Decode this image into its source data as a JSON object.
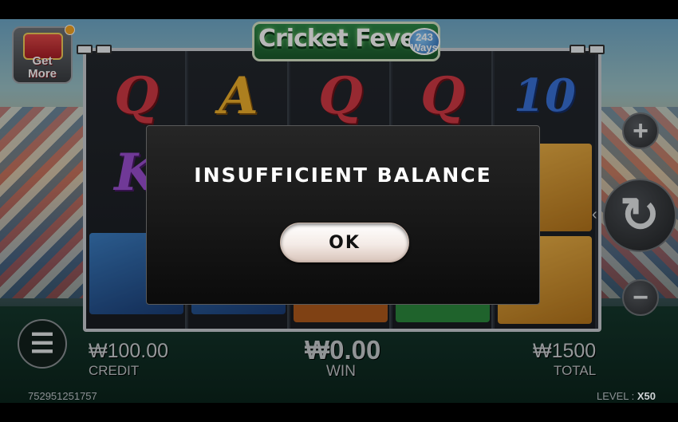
{
  "game": {
    "title": "Cricket Fever",
    "ways_badge": "243\nWays"
  },
  "get_more": {
    "label": "Get\nMore"
  },
  "reels": {
    "top_row": [
      "Q",
      "A",
      "Q",
      "Q",
      "10"
    ],
    "second_row_first": "K"
  },
  "controls": {
    "plus": "+",
    "minus": "−",
    "spin": "↻",
    "menu": "☰",
    "spin_hint": "‹"
  },
  "stats": {
    "credit_value": "₩100.00",
    "credit_label": "CREDIT",
    "win_value": "₩0.00",
    "win_label": "WIN",
    "total_value": "₩1500",
    "total_label": "TOTAL"
  },
  "footer": {
    "round_id": "752951251757",
    "level_label": "LEVEL :",
    "level_value": "X50"
  },
  "dialog": {
    "message": "INSUFFICIENT BALANCE",
    "ok_label": "OK"
  },
  "colors": {
    "modal_bg": "#0b0b0b",
    "ok_button": "#f4ebe6",
    "logo_green": "#2e8a48",
    "badge_orange": "#f5a623"
  }
}
